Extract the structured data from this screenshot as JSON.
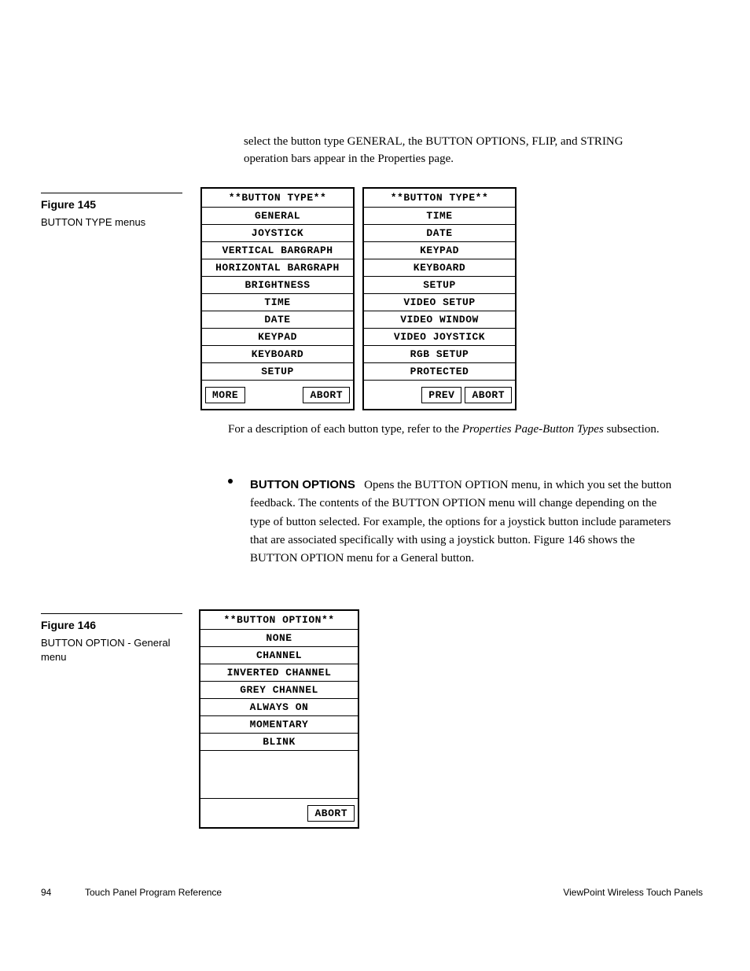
{
  "intro": "select the button type GENERAL, the BUTTON OPTIONS, FLIP, and STRING operation bars appear in the Properties page.",
  "fig145": {
    "num": "Figure 145",
    "caption": "BUTTON TYPE menus"
  },
  "menu1": {
    "header": "**BUTTON TYPE**",
    "items": [
      "GENERAL",
      "JOYSTICK",
      "VERTICAL BARGRAPH",
      "HORIZONTAL BARGRAPH",
      "BRIGHTNESS",
      "TIME",
      "DATE",
      "KEYPAD",
      "KEYBOARD",
      "SETUP"
    ],
    "foot_left": "MORE",
    "foot_right": "ABORT"
  },
  "menu2": {
    "header": "**BUTTON TYPE**",
    "items": [
      "TIME",
      "DATE",
      "KEYPAD",
      "KEYBOARD",
      "SETUP",
      "VIDEO SETUP",
      "VIDEO WINDOW",
      "VIDEO JOYSTICK",
      "RGB SETUP",
      "PROTECTED"
    ],
    "foot_left": "PREV",
    "foot_right": "ABORT"
  },
  "desc": {
    "pre": "For a description of each button type, refer to the ",
    "ital": "Properties Page-Button Types",
    "post": " subsection."
  },
  "bullet": {
    "lead": "BUTTON OPTIONS",
    "body": "Opens the BUTTON OPTION menu, in which you set the button feedback. The contents of the BUTTON OPTION menu will change depending on the type of button selected. For example, the options for a joystick button include parameters that are associated specifically with using a joystick button. Figure 146 shows the BUTTON OPTION menu for a General button."
  },
  "fig146": {
    "num": "Figure 146",
    "caption": "BUTTON OPTION - General menu"
  },
  "menu3": {
    "header": "**BUTTON OPTION**",
    "items": [
      "NONE",
      "CHANNEL",
      "INVERTED CHANNEL",
      "GREY CHANNEL",
      "ALWAYS ON",
      "MOMENTARY",
      "BLINK"
    ],
    "foot_right": "ABORT"
  },
  "footer": {
    "page": "94",
    "center": "Touch Panel Program Reference",
    "right": "ViewPoint Wireless Touch Panels"
  }
}
